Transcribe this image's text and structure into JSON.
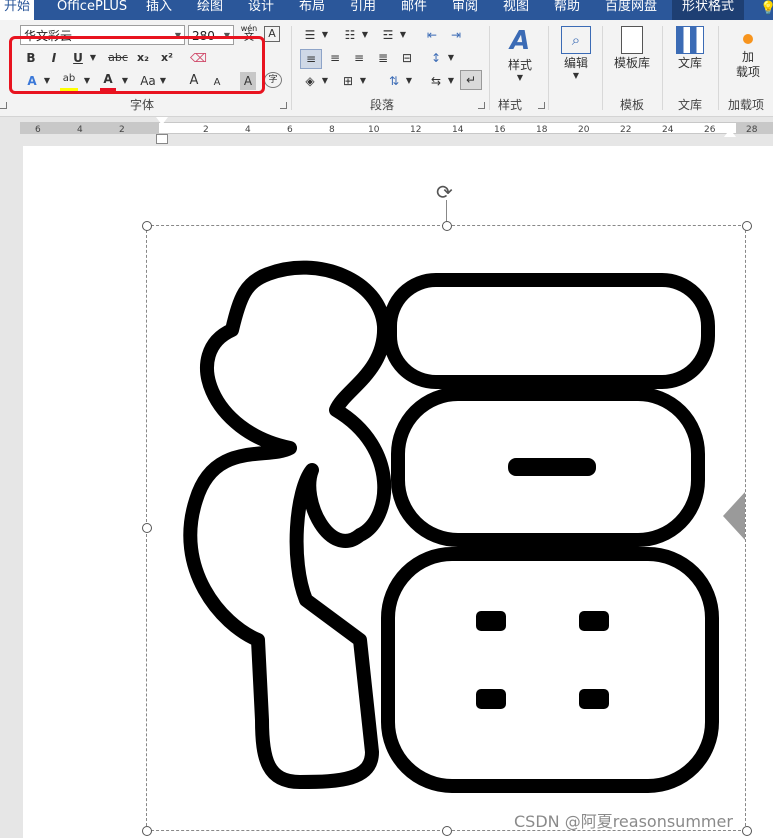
{
  "tabs": [
    "开始",
    "OfficePLUS",
    "插入",
    "绘图",
    "设计",
    "布局",
    "引用",
    "邮件",
    "审阅",
    "视图",
    "帮助",
    "百度网盘",
    "形状格式"
  ],
  "font": {
    "name": "华文彩云",
    "size": "280",
    "wen_top": "wén",
    "wen_bottom": "文",
    "bold": "B",
    "italic": "I",
    "underline": "U",
    "strike": "abc",
    "sub": "x₂",
    "sup": "x²",
    "grow": "A",
    "shrink": "A",
    "case": "Aa",
    "char_shade": "A",
    "enclose": "字"
  },
  "groups": {
    "font": "字体",
    "paragraph": "段落",
    "styles": "样式",
    "templates": "模板",
    "docs": "文库",
    "addins": "加载项"
  },
  "big_buttons": {
    "styles": "样式",
    "edit": "编辑",
    "template_lib": "模板库",
    "doc_lib": "文库",
    "addin": "加\n载项"
  },
  "ruler_labels": [
    "6",
    "4",
    "2",
    "2",
    "4",
    "6",
    "8",
    "10",
    "12",
    "14",
    "16",
    "18",
    "20",
    "22",
    "24",
    "26",
    "28"
  ],
  "glyph_char": "福",
  "watermark": "CSDN @阿夏reasonsummer",
  "colors": {
    "accent": "#2b579a",
    "highlight_box": "#e8131f",
    "font_color": "#e81123",
    "highlight_color": "#ffff00"
  }
}
